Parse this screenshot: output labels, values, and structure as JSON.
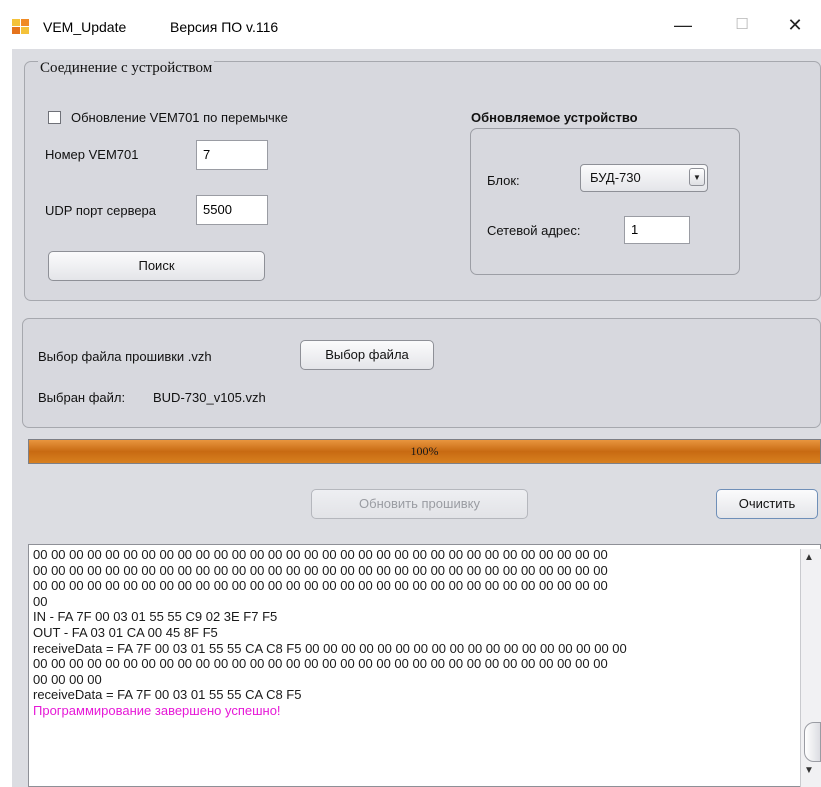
{
  "window": {
    "title": "VEM_Update",
    "version": "Версия ПО v.116",
    "controls": {
      "minimize": "—",
      "maximize": "☐",
      "close": "✕"
    }
  },
  "connection": {
    "legend": "Соединение с устройством",
    "jumper_update_label": "Обновление VEM701 по перемычке",
    "jumper_checked": false,
    "vem_number_label": "Номер VEM701",
    "vem_number_value": "7",
    "udp_port_label": "UDP порт сервера",
    "udp_port_value": "5500",
    "search_button": "Поиск"
  },
  "device": {
    "heading": "Обновляемое устройство",
    "block_label": "Блок:",
    "block_value": "БУД-730",
    "network_label": "Сетевой адрес:",
    "network_value": "1"
  },
  "file": {
    "select_label": "Выбор файла прошивки .vzh",
    "select_button": "Выбор файла",
    "selected_label": "Выбран файл:",
    "selected_name": "BUD-730_v105.vzh"
  },
  "progress": {
    "value": 1.0,
    "text": "100%"
  },
  "actions": {
    "update_button": "Обновить прошивку",
    "clear_button": "Очистить"
  },
  "log": {
    "lines": [
      "00 00 00 00 00 00 00 00 00 00 00 00 00 00 00 00 00 00 00 00 00 00 00 00 00 00 00 00 00 00 00 00",
      "00 00 00 00 00 00 00 00 00 00 00 00 00 00 00 00 00 00 00 00 00 00 00 00 00 00 00 00 00 00 00 00",
      "00 00 00 00 00 00 00 00 00 00 00 00 00 00 00 00 00 00 00 00 00 00 00 00 00 00 00 00 00 00 00 00",
      "00",
      "IN - FA 7F 00 03 01 55 55 C9 02 3E F7 F5",
      "OUT - FA 03 01 CA 00 45 8F F5",
      "receiveData = FA 7F 00 03 01 55 55 CA C8 F5 00 00 00 00 00 00 00 00 00 00 00 00 00 00 00 00 00 00",
      "00 00 00 00 00 00 00 00 00 00 00 00 00 00 00 00 00 00 00 00 00 00 00 00 00 00 00 00 00 00 00 00",
      "00 00 00 00",
      "receiveData = FA 7F 00 03 01 55 55 CA C8 F5"
    ],
    "success": "Программирование завершено успешно!"
  },
  "colors": {
    "client_bg": "#dcdde2",
    "progress_fill": "#d07a1c",
    "success_text": "#e619d7"
  }
}
